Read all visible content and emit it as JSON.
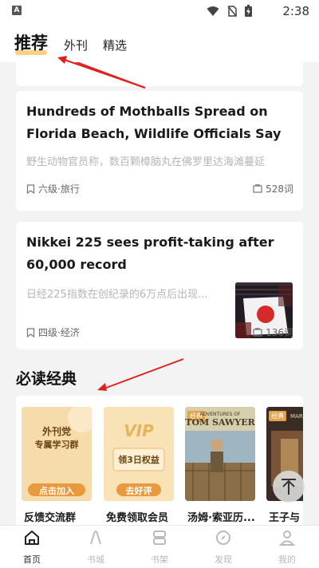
{
  "status_bar": {
    "app_badge": "A",
    "time": "2:38"
  },
  "tabs": [
    {
      "label": "推荐",
      "active": true
    },
    {
      "label": "外刊",
      "active": false
    },
    {
      "label": "精选",
      "active": false
    }
  ],
  "articles": [
    {
      "title": "Hundreds of Mothballs Spread on Florida Beach, Wildlife Officials Say",
      "summary": "野生动物官员称，数百颗樟脑丸在佛罗里达海滩蔓延",
      "level": "六级·旅行",
      "word_count": "528词"
    },
    {
      "title": "Nikkei 225 sees profit-taking after 60,000 record",
      "summary": "日经225指数在创纪录的6万点后出现...",
      "level": "四级·经济",
      "word_count": "136词"
    }
  ],
  "section": {
    "title": "必读经典"
  },
  "books": [
    {
      "label": "反馈交流群",
      "cover_line1": "外刊党",
      "cover_line2": "专属学习群",
      "cover_button": "点击加入"
    },
    {
      "label": "免费领取会员",
      "cover_vip": "VIP",
      "cover_line": "领3日权益",
      "cover_button": "去好评"
    },
    {
      "label": "汤姆·索亚历...",
      "cover_tag": "经典",
      "cover_title_small": "ADVENTURES OF",
      "cover_title": "TOM SAWYER"
    },
    {
      "label": "王子与",
      "cover_tag": "经典",
      "cover_title": "MARK"
    }
  ],
  "bottom_nav": [
    {
      "label": "首页",
      "icon": "home-icon",
      "active": true
    },
    {
      "label": "书城",
      "icon": "bookstore-icon",
      "active": false
    },
    {
      "label": "书架",
      "icon": "bookshelf-icon",
      "active": false
    },
    {
      "label": "发现",
      "icon": "compass-icon",
      "active": false
    },
    {
      "label": "我的",
      "icon": "user-icon",
      "active": false
    }
  ],
  "colors": {
    "accent": "#f6c667",
    "book_button": "#e99a3c",
    "summary": "#b5b5b5"
  }
}
